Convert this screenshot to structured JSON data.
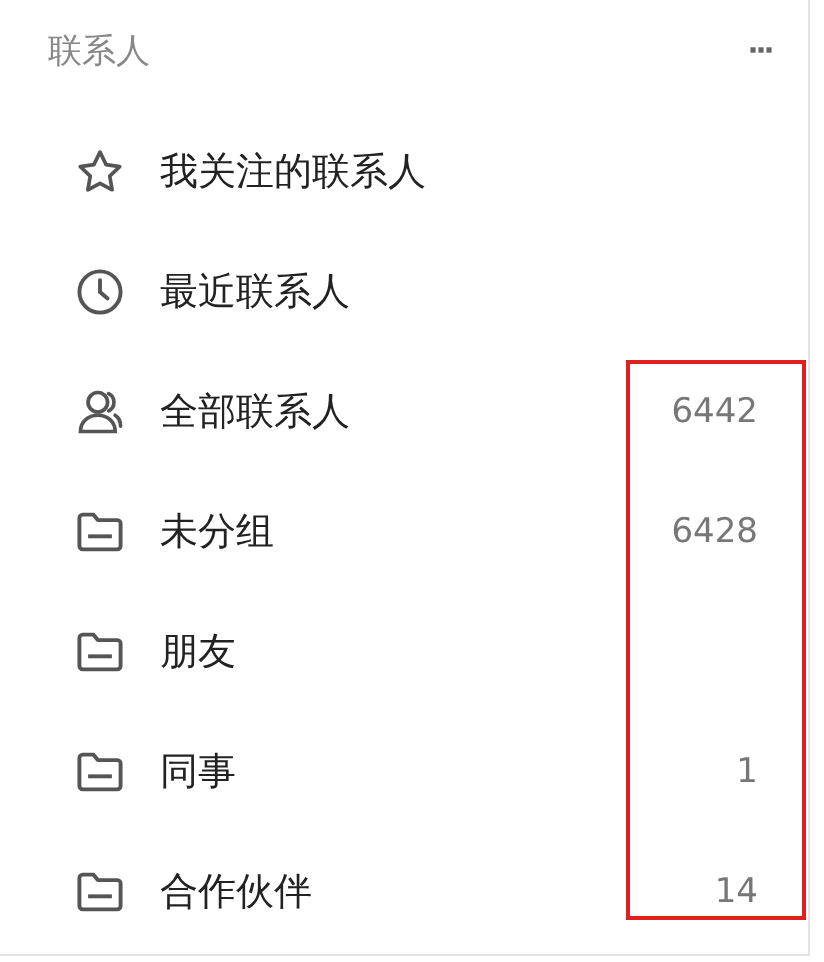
{
  "header": {
    "title": "联系人",
    "menu": "···"
  },
  "items": [
    {
      "kind": "star",
      "label": "我关注的联系人"
    },
    {
      "kind": "clock",
      "label": "最近联系人"
    },
    {
      "kind": "person",
      "label": "全部联系人",
      "count": "6442"
    },
    {
      "kind": "folder",
      "label": "未分组",
      "count": "6428"
    },
    {
      "kind": "folder",
      "label": "朋友"
    },
    {
      "kind": "folder",
      "label": "同事",
      "count": "1"
    },
    {
      "kind": "folder",
      "label": "合作伙伴",
      "count": "14"
    }
  ]
}
